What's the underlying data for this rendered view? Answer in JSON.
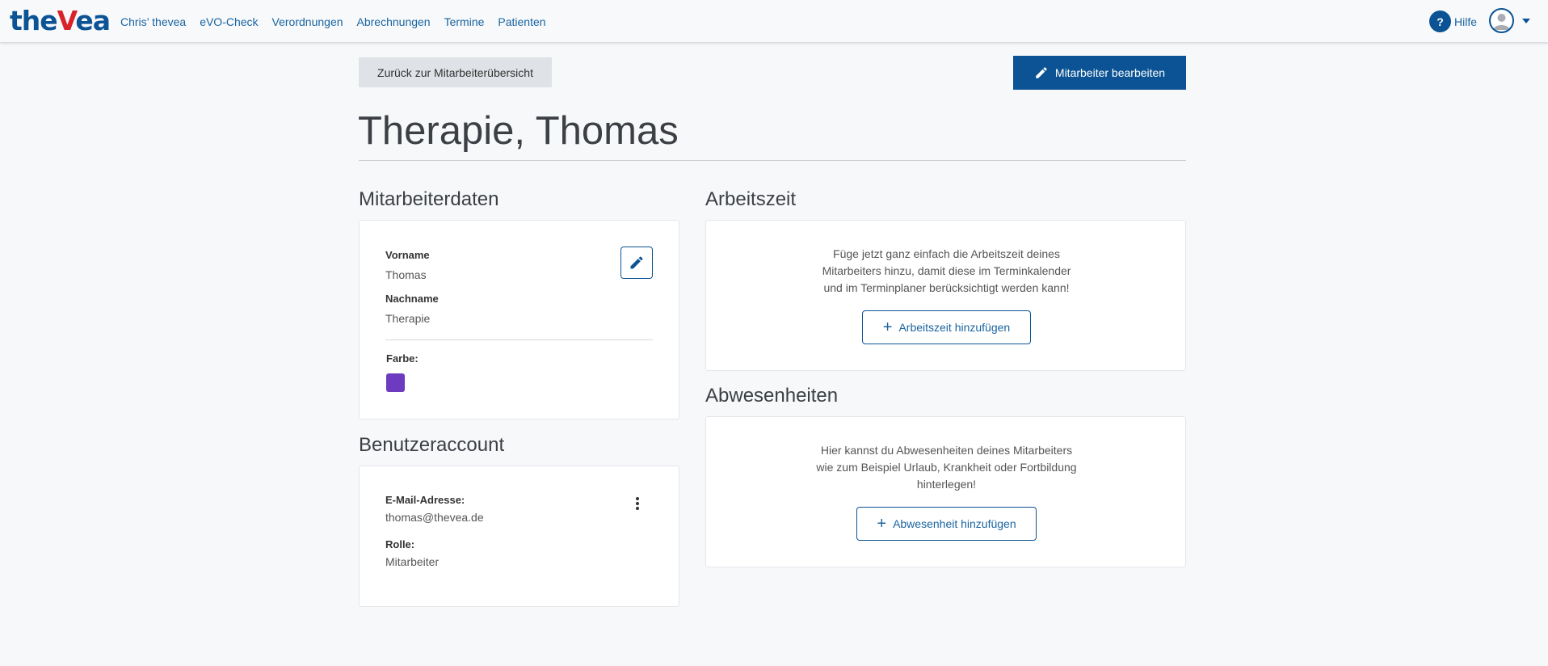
{
  "brand": {
    "logo_part1": "the",
    "logo_part2": "V",
    "logo_part3": "ea"
  },
  "nav": {
    "items": [
      {
        "label": "Chris’ thevea"
      },
      {
        "label": "eVO-Check"
      },
      {
        "label": "Verordnungen"
      },
      {
        "label": "Abrechnungen"
      },
      {
        "label": "Termine"
      },
      {
        "label": "Patienten"
      }
    ],
    "help_label": "Hilfe"
  },
  "actions": {
    "back_label": "Zurück zur Mitarbeiterübersicht",
    "edit_label": "Mitarbeiter bearbeiten"
  },
  "page": {
    "title": "Therapie, Thomas"
  },
  "employee_data": {
    "section_title": "Mitarbeiterdaten",
    "firstname_label": "Vorname",
    "firstname_value": "Thomas",
    "lastname_label": "Nachname",
    "lastname_value": "Therapie",
    "color_label": "Farbe:",
    "color_value": "#6c3bbf"
  },
  "user_account": {
    "section_title": "Benutzeraccount",
    "email_label": "E-Mail-Adresse:",
    "email_value": "thomas@thevea.de",
    "role_label": "Rolle:",
    "role_value": "Mitarbeiter"
  },
  "working_time": {
    "section_title": "Arbeitszeit",
    "empty_line1": "Füge jetzt ganz einfach die Arbeitszeit deines",
    "empty_line2": "Mitarbeiters hinzu, damit diese im Terminkalender",
    "empty_line3": "und im Terminplaner berücksichtigt werden kann!",
    "add_label": "Arbeitszeit hinzufügen"
  },
  "absences": {
    "section_title": "Abwesenheiten",
    "empty_line1": "Hier kannst du Abwesenheiten deines Mitarbeiters",
    "empty_line2": "wie zum Beispiel Urlaub, Krankheit oder Fortbildung",
    "empty_line3": "hinterlegen!",
    "add_label": "Abwesenheit hinzufügen"
  },
  "colors": {
    "primary": "#0b5394",
    "link": "#1a64a0",
    "logo_red": "#d8232a"
  }
}
